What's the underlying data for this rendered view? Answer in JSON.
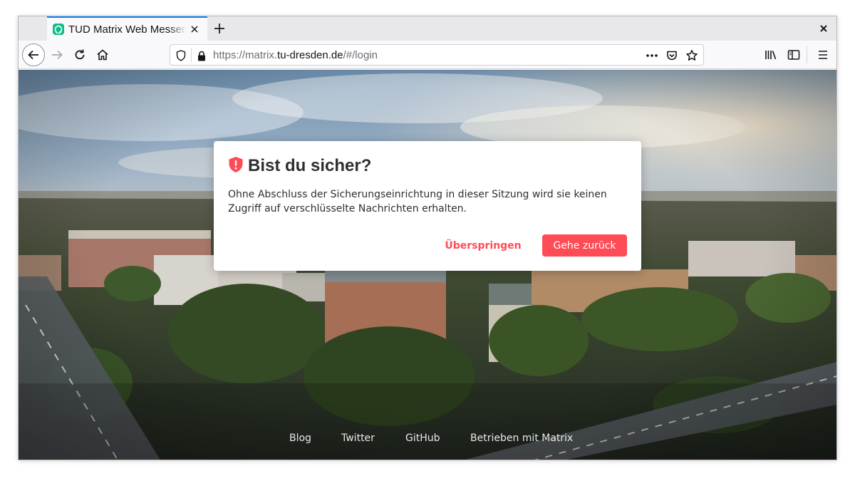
{
  "browser": {
    "tab": {
      "title": "TUD Matrix Web Messenger",
      "favicon": "element-logo-icon"
    },
    "url": {
      "prefix": "https://matrix.",
      "domain": "tu-dresden.de",
      "path": "/#/login"
    }
  },
  "dialog": {
    "icon": "shield-warning-icon",
    "title": "Bist du sicher?",
    "body": "Ohne Abschluss der Sicherungseinrichtung in dieser Sitzung wird sie keinen Zugriff auf verschlüsselte Nachrichten erhalten.",
    "skip_label": "Überspringen",
    "back_label": "Gehe zurück"
  },
  "footer": {
    "links": [
      "Blog",
      "Twitter",
      "GitHub",
      "Betrieben mit Matrix"
    ]
  },
  "colors": {
    "accent": "#ff4b55",
    "tab_highlight": "#0a84ff",
    "favicon": "#0dbd8b"
  }
}
